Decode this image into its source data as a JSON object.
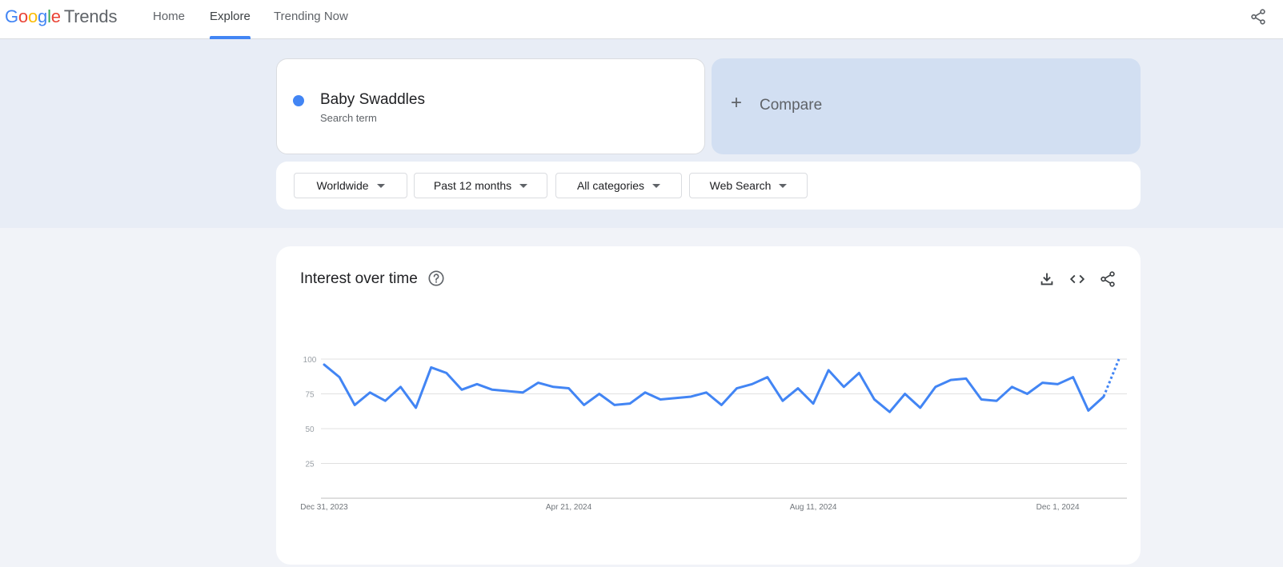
{
  "header": {
    "logo_google": [
      "G",
      "o",
      "o",
      "g",
      "l",
      "e"
    ],
    "logo_trends": "Trends",
    "nav": [
      {
        "label": "Home",
        "active": false
      },
      {
        "label": "Explore",
        "active": true
      },
      {
        "label": "Trending Now",
        "active": false
      }
    ],
    "share_icon": "share-icon"
  },
  "search": {
    "term": "Baby Swaddles",
    "term_type": "Search term",
    "term_color": "#4285f4",
    "compare_label": "Compare"
  },
  "filters": [
    {
      "label": "Worldwide"
    },
    {
      "label": "Past 12 months"
    },
    {
      "label": "All categories"
    },
    {
      "label": "Web Search"
    }
  ],
  "panel": {
    "title": "Interest over time",
    "icons": [
      "help-icon",
      "download-icon",
      "embed-icon",
      "share-icon"
    ]
  },
  "chart_data": {
    "type": "line",
    "y_ticks": [
      100,
      75,
      50,
      25
    ],
    "ylim": [
      0,
      100
    ],
    "x_tick_labels": [
      "Dec 31, 2023",
      "Apr 21, 2024",
      "Aug 11, 2024",
      "Dec 1, 2024"
    ],
    "series": [
      {
        "color": "#4285f4",
        "values": [
          96,
          87,
          67,
          76,
          70,
          80,
          65,
          94,
          90,
          78,
          82,
          78,
          77,
          76,
          83,
          80,
          79,
          67,
          75,
          67,
          68,
          76,
          71,
          72,
          73,
          76,
          67,
          79,
          82,
          87,
          70,
          79,
          68,
          92,
          80,
          90,
          71,
          62,
          75,
          65,
          80,
          85,
          86,
          71,
          70,
          80,
          75,
          83,
          82,
          87,
          63,
          73,
          100
        ],
        "partial_last": true
      }
    ]
  }
}
